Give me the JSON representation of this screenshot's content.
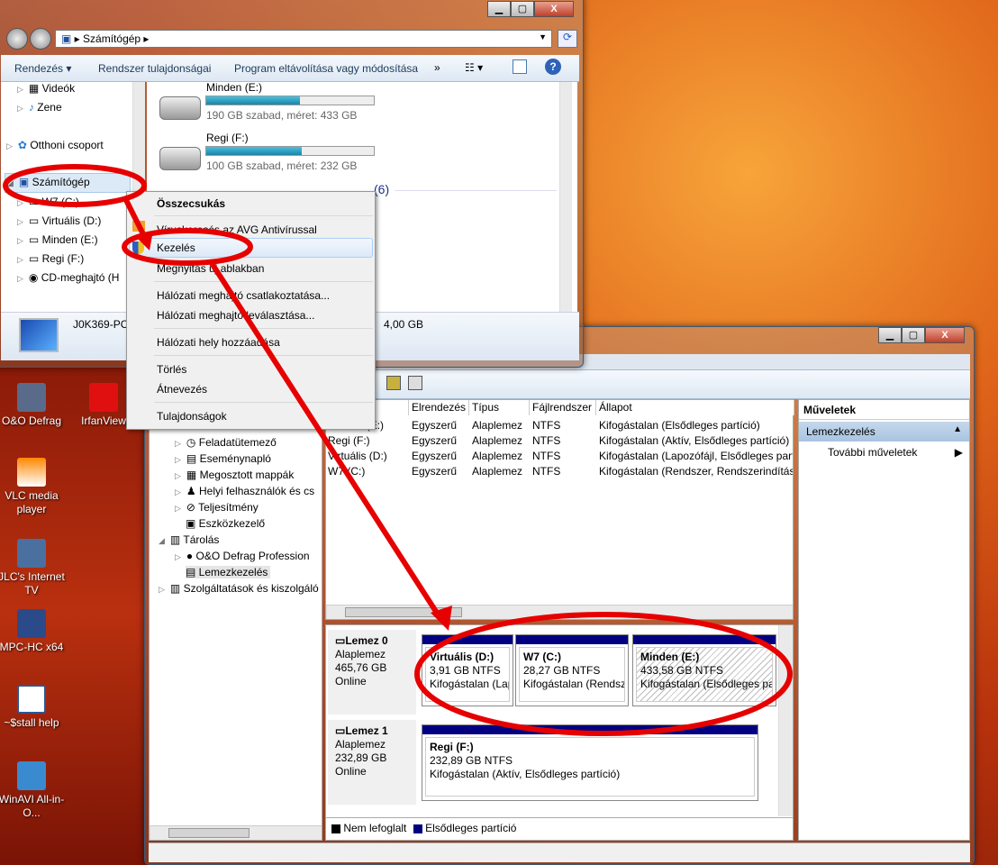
{
  "desktop": {
    "icons": [
      {
        "label": "O&O Defrag"
      },
      {
        "label": "IrfanView"
      },
      {
        "label": "VLC media player"
      },
      {
        "label": "JLC's Internet TV"
      },
      {
        "label": "MPC-HC x64"
      },
      {
        "label": "~$stall help"
      },
      {
        "label": "WinAVI All-in-O..."
      }
    ]
  },
  "explorer": {
    "address": {
      "crumb": "Számítógép"
    },
    "toolbar": {
      "organize": "Rendezés ▾",
      "system_properties": "Rendszer tulajdonságai",
      "uninstall": "Program eltávolítása vagy módosítása",
      "more": "»"
    },
    "nav": [
      {
        "label": "Videók"
      },
      {
        "label": "Zene"
      },
      {
        "label": "Otthoni csoport"
      },
      {
        "label": "Számítógép"
      },
      {
        "label": "W7 (C:)"
      },
      {
        "label": "Virtuális (D:)"
      },
      {
        "label": "Minden (E:)"
      },
      {
        "label": "Regi (F:)"
      },
      {
        "label": "CD-meghajtó (H"
      }
    ],
    "drives": [
      {
        "name": "Minden (E:)",
        "info": "190 GB szabad, méret: 433 GB",
        "used_fraction": 0.56
      },
      {
        "name": "Regi (F:)",
        "info": "100 GB szabad, méret: 232 GB",
        "used_fraction": 0.57
      }
    ],
    "group_count": "(6)",
    "details": {
      "pc_name": "J0K369-PC",
      "memory": "4,00 GB"
    }
  },
  "context_menu": {
    "items": [
      "Összecsukás",
      "Víruskeresés az AVG Antivírussal",
      "Kezelés",
      "Megnyitás új ablakban",
      "Hálózati meghajtó csatlakoztatása...",
      "Hálózati meghajtó leválasztása...",
      "Hálózati hely hozzáadása",
      "Törlés",
      "Átnevezés",
      "Tulajdonságok"
    ]
  },
  "mgmt": {
    "tree": [
      "Feladatütemező",
      "Eseménynapló",
      "Megosztott mappák",
      "Helyi felhasználók és cs",
      "Teljesítmény",
      "Eszközkezelő",
      "Tárolás",
      "O&O Defrag Profession",
      "Lemezkezelés",
      "Szolgáltatások és kiszolgáló"
    ],
    "columns": [
      "Elrendezés",
      "Típus",
      "Fájlrendszer",
      "Állapot"
    ],
    "volumes": [
      {
        "name": "Minden (E:)",
        "layout": "Egyszerű",
        "type": "Alaplemez",
        "fs": "NTFS",
        "status": "Kifogástalan (Elsődleges partíció)"
      },
      {
        "name": "Regi (F:)",
        "layout": "Egyszerű",
        "type": "Alaplemez",
        "fs": "NTFS",
        "status": "Kifogástalan (Aktív, Elsődleges partíció)"
      },
      {
        "name": "Virtuális (D:)",
        "layout": "Egyszerű",
        "type": "Alaplemez",
        "fs": "NTFS",
        "status": "Kifogástalan (Lapozófájl, Elsődleges partíció)"
      },
      {
        "name": "W7 (C:)",
        "layout": "Egyszerű",
        "type": "Alaplemez",
        "fs": "NTFS",
        "status": "Kifogástalan (Rendszer, Rendszerindítás, A"
      }
    ],
    "disks": [
      {
        "name": "Lemez 0",
        "type": "Alaplemez",
        "size": "465,76 GB",
        "state": "Online",
        "partitions": [
          {
            "name": "Virtuális  (D:)",
            "size": "3,91 GB NTFS",
            "status": "Kifogástalan (Lapozófájl, Elsődleges partíció)"
          },
          {
            "name": "W7  (C:)",
            "size": "28,27 GB NTFS",
            "status": "Kifogástalan (Rendszer, Rendszerindítás)"
          },
          {
            "name": "Minden  (E:)",
            "size": "433,58 GB NTFS",
            "status": "Kifogástalan (Elsődleges partíció)"
          }
        ]
      },
      {
        "name": "Lemez 1",
        "type": "Alaplemez",
        "size": "232,89 GB",
        "state": "Online",
        "partitions": [
          {
            "name": "Regi  (F:)",
            "size": "232,89 GB NTFS",
            "status": "Kifogástalan (Aktív, Elsődleges partíció)"
          }
        ]
      }
    ],
    "legend": [
      "Nem lefoglalt",
      "Elsődleges partíció"
    ],
    "actions": {
      "title": "Műveletek",
      "section": "Lemezkezelés",
      "more": "További műveletek"
    }
  },
  "colors": {
    "annotation": "#e60000",
    "primary_partition": "#000080",
    "unallocated": "#000000"
  }
}
